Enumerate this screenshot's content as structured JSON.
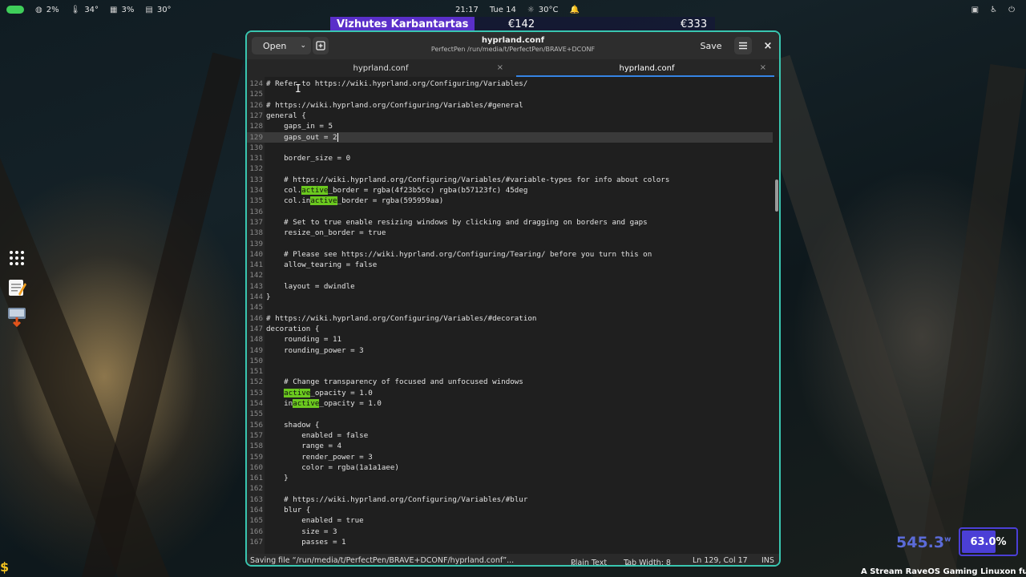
{
  "topbar": {
    "cpu": "2%",
    "temp": "34°",
    "mem": "3%",
    "disk": "30°",
    "time": "21:17",
    "date": "Tue 14",
    "weather": "30°C"
  },
  "ticker": {
    "title": "Vizhutes Karbantartas",
    "price1": "€142",
    "price2": "€333"
  },
  "editor": {
    "open_label": "Open",
    "save_label": "Save",
    "title": "hyprland.conf",
    "subtitle": "PerfectPen /run/media/t/PerfectPen/BRAVE+DCONF",
    "tabs": [
      {
        "label": "hyprland.conf"
      },
      {
        "label": "hyprland.conf"
      }
    ],
    "cursor_line": 129,
    "lines": [
      {
        "n": "124",
        "t": "# Refer to https://wiki.hyprland.org/Configuring/Variables/"
      },
      {
        "n": "125",
        "t": ""
      },
      {
        "n": "126",
        "t": "# https://wiki.hyprland.org/Configuring/Variables/#general"
      },
      {
        "n": "127",
        "t": "general {"
      },
      {
        "n": "128",
        "t": "    gaps_in = 5"
      },
      {
        "n": "129",
        "t": "    gaps_out = 2"
      },
      {
        "n": "130",
        "t": ""
      },
      {
        "n": "131",
        "t": "    border_size = 0"
      },
      {
        "n": "132",
        "t": ""
      },
      {
        "n": "133",
        "t": "    # https://wiki.hyprland.org/Configuring/Variables/#variable-types for info about colors"
      },
      {
        "n": "134",
        "t": "    col.active_border = rgba(4f23b5cc) rgba(b57123fc) 45deg"
      },
      {
        "n": "135",
        "t": "    col.inactive_border = rgba(595959aa)"
      },
      {
        "n": "136",
        "t": ""
      },
      {
        "n": "137",
        "t": "    # Set to true enable resizing windows by clicking and dragging on borders and gaps"
      },
      {
        "n": "138",
        "t": "    resize_on_border = true"
      },
      {
        "n": "139",
        "t": ""
      },
      {
        "n": "140",
        "t": "    # Please see https://wiki.hyprland.org/Configuring/Tearing/ before you turn this on"
      },
      {
        "n": "141",
        "t": "    allow_tearing = false"
      },
      {
        "n": "142",
        "t": ""
      },
      {
        "n": "143",
        "t": "    layout = dwindle"
      },
      {
        "n": "144",
        "t": "}"
      },
      {
        "n": "145",
        "t": ""
      },
      {
        "n": "146",
        "t": "# https://wiki.hyprland.org/Configuring/Variables/#decoration"
      },
      {
        "n": "147",
        "t": "decoration {"
      },
      {
        "n": "148",
        "t": "    rounding = 11"
      },
      {
        "n": "149",
        "t": "    rounding_power = 3"
      },
      {
        "n": "150",
        "t": ""
      },
      {
        "n": "151",
        "t": ""
      },
      {
        "n": "152",
        "t": "    # Change transparency of focused and unfocused windows"
      },
      {
        "n": "153",
        "t": "    active_opacity = 1.0"
      },
      {
        "n": "154",
        "t": "    inactive_opacity = 1.0"
      },
      {
        "n": "155",
        "t": ""
      },
      {
        "n": "156",
        "t": "    shadow {"
      },
      {
        "n": "157",
        "t": "        enabled = false"
      },
      {
        "n": "158",
        "t": "        range = 4"
      },
      {
        "n": "159",
        "t": "        render_power = 3"
      },
      {
        "n": "160",
        "t": "        color = rgba(1a1a1aee)"
      },
      {
        "n": "161",
        "t": "    }"
      },
      {
        "n": "162",
        "t": ""
      },
      {
        "n": "163",
        "t": "    # https://wiki.hyprland.org/Configuring/Variables/#blur"
      },
      {
        "n": "164",
        "t": "    blur {"
      },
      {
        "n": "165",
        "t": "        enabled = true"
      },
      {
        "n": "166",
        "t": "        size = 3"
      },
      {
        "n": "167",
        "t": "        passes = 1"
      }
    ],
    "highlight_word": "active",
    "status": {
      "message": "Saving file “/run/media/t/PerfectPen/BRAVE+DCONF/hyprland.conf”...",
      "language": "Plain Text",
      "tab_width": "Tab Width: 8",
      "position": "Ln 129, Col 17",
      "mode": "INS"
    }
  },
  "widgets": {
    "power_value": "545.3",
    "power_unit": "w",
    "battery_label": "63.0%",
    "battery_level": 0.63,
    "marquee": "A Stream RaveOS Gaming Linuxon fut"
  },
  "colors": {
    "accent_border": "#39c6b0",
    "highlight": "#6bc91f",
    "tab_indicator": "#3584e4",
    "ticker_bg": "#5a2fc9"
  }
}
